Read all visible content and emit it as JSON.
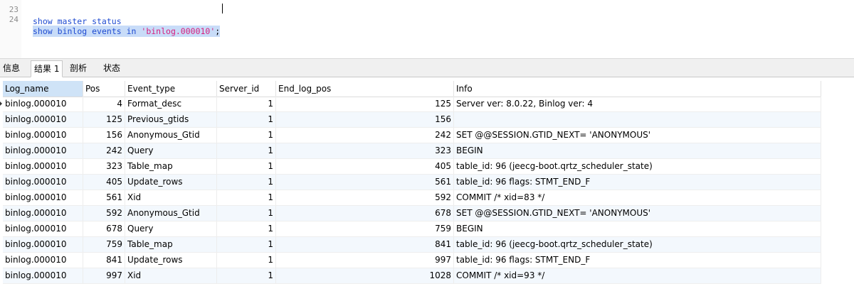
{
  "editor": {
    "partial_line_number": "23",
    "partial_line_text": "show master status",
    "line_number": "24",
    "kw1": "show",
    "kw2": "binlog",
    "kw3": "events",
    "kw4": "in",
    "string_literal": "'binlog.000010'",
    "terminator": ";"
  },
  "tabs": [
    {
      "label": "信息"
    },
    {
      "label": "结果 1",
      "active": true
    },
    {
      "label": "剖析"
    },
    {
      "label": "状态"
    }
  ],
  "table": {
    "columns": [
      "Log_name",
      "Pos",
      "Event_type",
      "Server_id",
      "End_log_pos",
      "Info"
    ],
    "rows": [
      [
        "binlog.000010",
        "4",
        "Format_desc",
        "1",
        "125",
        "Server ver: 8.0.22, Binlog ver: 4"
      ],
      [
        "binlog.000010",
        "125",
        "Previous_gtids",
        "1",
        "156",
        ""
      ],
      [
        "binlog.000010",
        "156",
        "Anonymous_Gtid",
        "1",
        "242",
        "SET @@SESSION.GTID_NEXT= 'ANONYMOUS'"
      ],
      [
        "binlog.000010",
        "242",
        "Query",
        "1",
        "323",
        "BEGIN"
      ],
      [
        "binlog.000010",
        "323",
        "Table_map",
        "1",
        "405",
        "table_id: 96 (jeecg-boot.qrtz_scheduler_state)"
      ],
      [
        "binlog.000010",
        "405",
        "Update_rows",
        "1",
        "561",
        "table_id: 96 flags: STMT_END_F"
      ],
      [
        "binlog.000010",
        "561",
        "Xid",
        "1",
        "592",
        "COMMIT /* xid=83 */"
      ],
      [
        "binlog.000010",
        "592",
        "Anonymous_Gtid",
        "1",
        "678",
        "SET @@SESSION.GTID_NEXT= 'ANONYMOUS'"
      ],
      [
        "binlog.000010",
        "678",
        "Query",
        "1",
        "759",
        "BEGIN"
      ],
      [
        "binlog.000010",
        "759",
        "Table_map",
        "1",
        "841",
        "table_id: 96 (jeecg-boot.qrtz_scheduler_state)"
      ],
      [
        "binlog.000010",
        "841",
        "Update_rows",
        "1",
        "997",
        "table_id: 96 flags: STMT_END_F"
      ],
      [
        "binlog.000010",
        "997",
        "Xid",
        "1",
        "1028",
        "COMMIT /* xid=93 */"
      ]
    ]
  }
}
